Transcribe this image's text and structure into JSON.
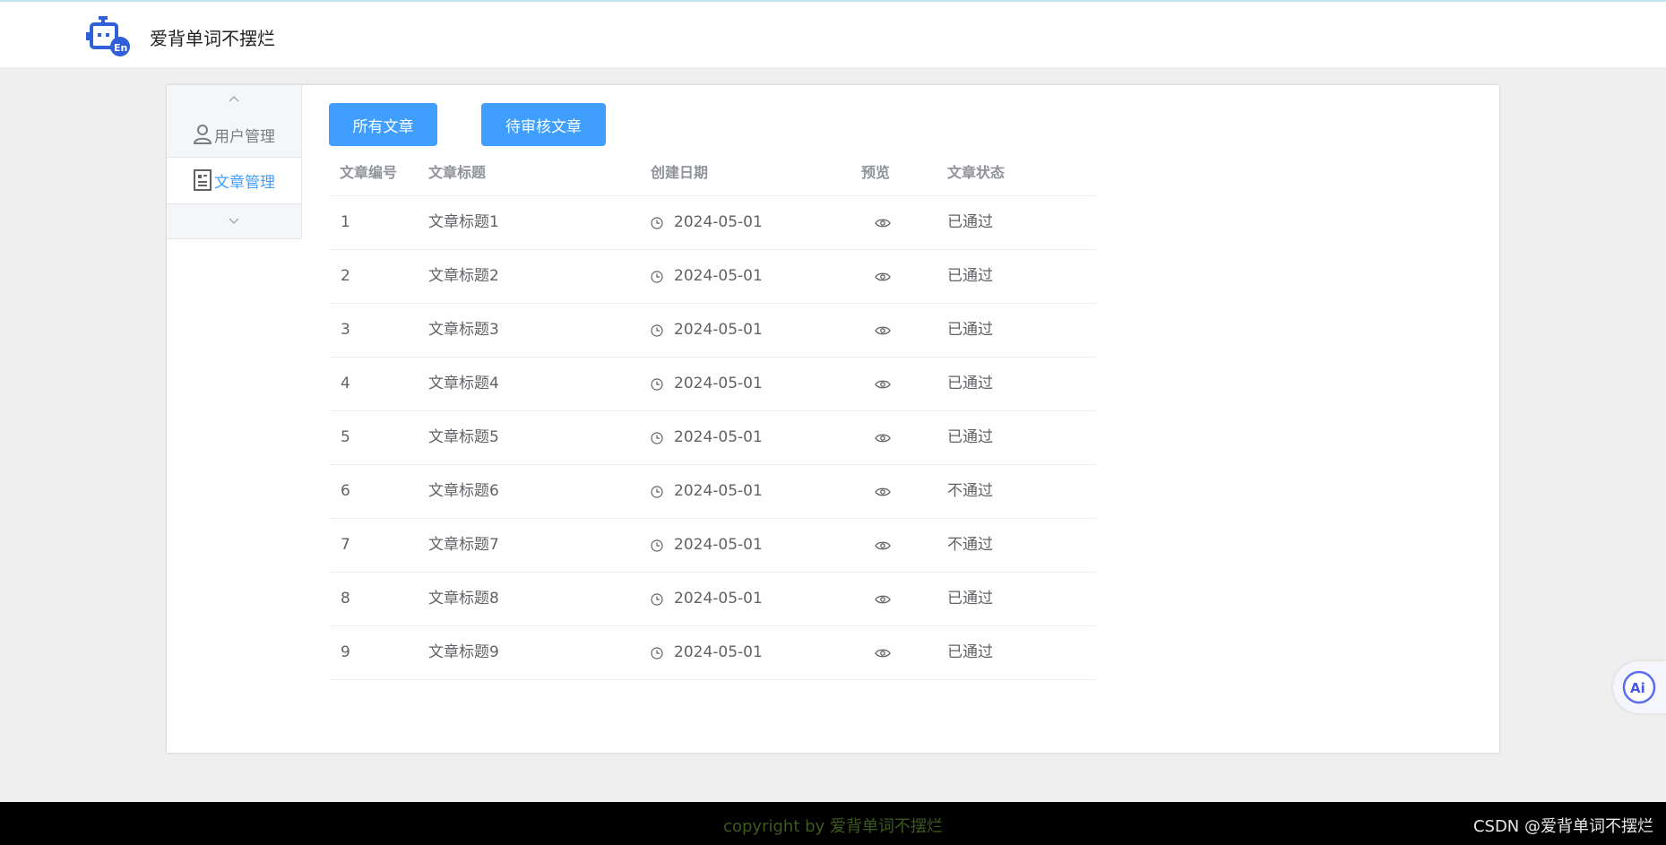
{
  "app": {
    "title": "爱背单词不摆烂"
  },
  "sidebar": {
    "items": [
      {
        "label": "用户管理",
        "icon": "user-icon",
        "active": false
      },
      {
        "label": "文章管理",
        "icon": "document-icon",
        "active": true
      }
    ]
  },
  "toolbar": {
    "all_label": "所有文章",
    "pending_label": "待审核文章"
  },
  "table": {
    "headers": {
      "id": "文章编号",
      "title": "文章标题",
      "date": "创建日期",
      "preview": "预览",
      "status": "文章状态"
    },
    "rows": [
      {
        "id": "1",
        "title": "文章标题1",
        "date": "2024-05-01",
        "status": "已通过"
      },
      {
        "id": "2",
        "title": "文章标题2",
        "date": "2024-05-01",
        "status": "已通过"
      },
      {
        "id": "3",
        "title": "文章标题3",
        "date": "2024-05-01",
        "status": "已通过"
      },
      {
        "id": "4",
        "title": "文章标题4",
        "date": "2024-05-01",
        "status": "已通过"
      },
      {
        "id": "5",
        "title": "文章标题5",
        "date": "2024-05-01",
        "status": "已通过"
      },
      {
        "id": "6",
        "title": "文章标题6",
        "date": "2024-05-01",
        "status": "不通过"
      },
      {
        "id": "7",
        "title": "文章标题7",
        "date": "2024-05-01",
        "status": "不通过"
      },
      {
        "id": "8",
        "title": "文章标题8",
        "date": "2024-05-01",
        "status": "已通过"
      },
      {
        "id": "9",
        "title": "文章标题9",
        "date": "2024-05-01",
        "status": "已通过"
      }
    ]
  },
  "footer": {
    "copyright": "copyright by 爱背单词不摆烂",
    "watermark": "CSDN @爱背单词不摆烂"
  },
  "colors": {
    "primary": "#409eff",
    "footer_bg": "#000000",
    "page_bg": "#efefef"
  }
}
